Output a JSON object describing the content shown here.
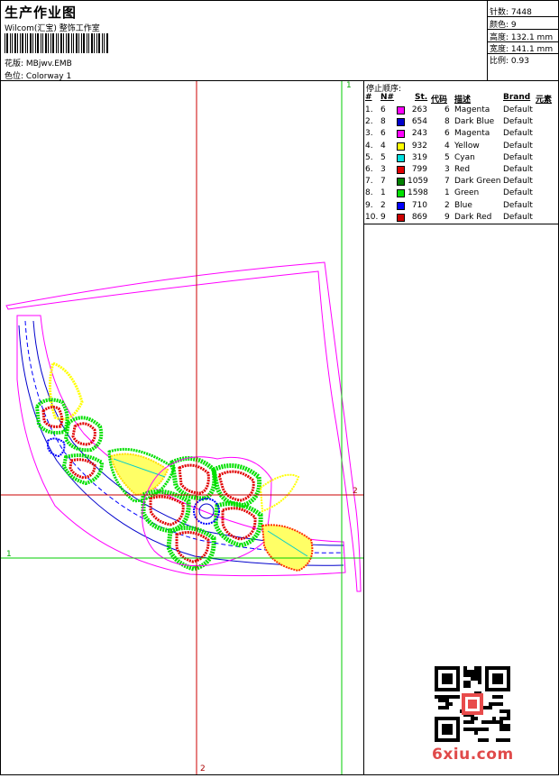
{
  "header": {
    "title": "生产作业图",
    "company": "Wilcom(汇宝) 整饰工作室",
    "design_label": "花版:",
    "design_value": "MBjwv.EMB",
    "colorway_label": "色位:",
    "colorway_value": "Colorway 1"
  },
  "stats": [
    {
      "label": "针数:",
      "value": "7448"
    },
    {
      "label": "颜色:",
      "value": "9"
    },
    {
      "label": "高度:",
      "value": "132.1 mm"
    },
    {
      "label": "宽度:",
      "value": "141.1 mm"
    },
    {
      "label": "比例:",
      "value": "0.93"
    }
  ],
  "stop_sequence": {
    "title": "停止顺序:",
    "headers": [
      "#",
      "N#",
      "St.",
      "代码",
      "描述",
      "Brand",
      "元素"
    ],
    "rows": [
      {
        "idx": "1.",
        "n": "6",
        "color": "#ff00ff",
        "st": "263",
        "code": "6",
        "desc": "Magenta",
        "brand": "Default"
      },
      {
        "idx": "2.",
        "n": "8",
        "color": "#0000cc",
        "st": "654",
        "code": "8",
        "desc": "Dark Blue",
        "brand": "Default"
      },
      {
        "idx": "3.",
        "n": "6",
        "color": "#ff00ff",
        "st": "243",
        "code": "6",
        "desc": "Magenta",
        "brand": "Default"
      },
      {
        "idx": "4.",
        "n": "4",
        "color": "#ffff00",
        "st": "932",
        "code": "4",
        "desc": "Yellow",
        "brand": "Default"
      },
      {
        "idx": "5.",
        "n": "5",
        "color": "#00e0e0",
        "st": "319",
        "code": "5",
        "desc": "Cyan",
        "brand": "Default"
      },
      {
        "idx": "6.",
        "n": "3",
        "color": "#e00000",
        "st": "799",
        "code": "3",
        "desc": "Red",
        "brand": "Default"
      },
      {
        "idx": "7.",
        "n": "7",
        "color": "#008000",
        "st": "1059",
        "code": "7",
        "desc": "Dark Green",
        "brand": "Default"
      },
      {
        "idx": "8.",
        "n": "1",
        "color": "#00e000",
        "st": "1598",
        "code": "1",
        "desc": "Green",
        "brand": "Default"
      },
      {
        "idx": "9.",
        "n": "2",
        "color": "#0000ff",
        "st": "710",
        "code": "2",
        "desc": "Blue",
        "brand": "Default"
      },
      {
        "idx": "10.",
        "n": "9",
        "color": "#cc0000",
        "st": "869",
        "code": "9",
        "desc": "Dark Red",
        "brand": "Default"
      }
    ]
  },
  "guides": {
    "green_v": "1",
    "green_h": "1",
    "red_v": "2",
    "red_h": "2"
  },
  "watermark": "6xiu.com",
  "colors": {
    "magenta": "#ff00ff",
    "blue": "#0000ff",
    "green": "#00e000",
    "dark_green": "#008000",
    "red": "#e00000",
    "yellow": "#ffff00",
    "guide_red": "#cc0000",
    "guide_green": "#00cc00"
  }
}
